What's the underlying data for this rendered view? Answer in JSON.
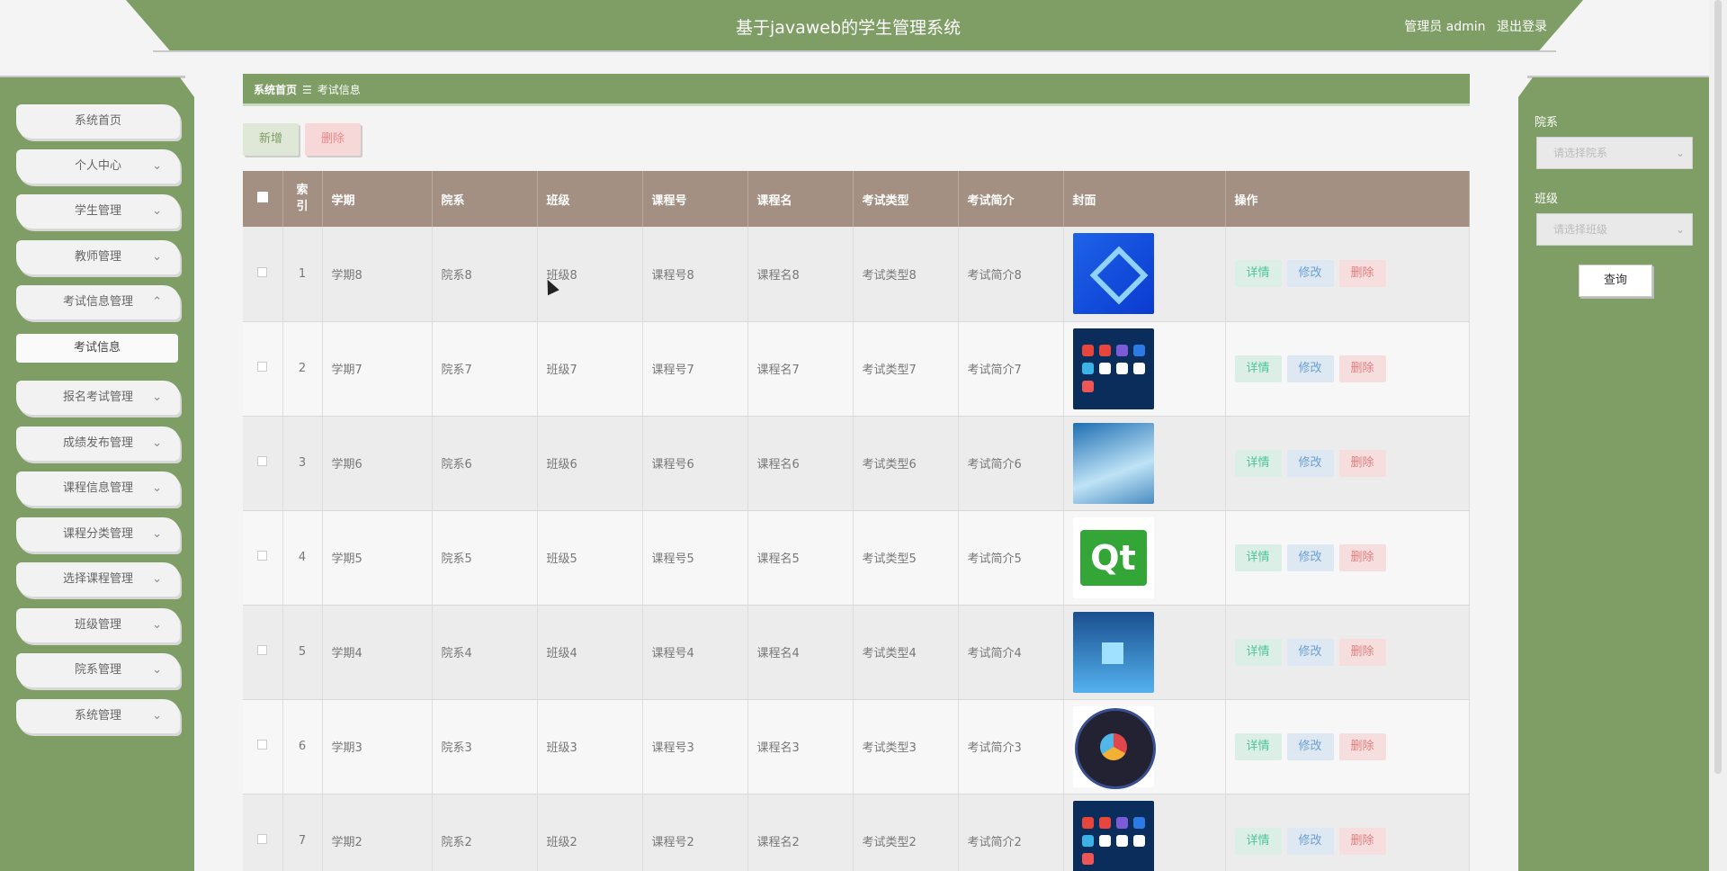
{
  "header": {
    "title": "基于javaweb的学生管理系统",
    "user": "管理员 admin",
    "logout": "退出登录"
  },
  "sidebar": {
    "items": [
      {
        "label": "系统首页",
        "chevron": ""
      },
      {
        "label": "个人中心",
        "chevron": "⌄"
      },
      {
        "label": "学生管理",
        "chevron": "⌄"
      },
      {
        "label": "教师管理",
        "chevron": "⌄"
      },
      {
        "label": "考试信息管理",
        "chevron": "⌃"
      },
      {
        "label": "报名考试管理",
        "chevron": "⌄"
      },
      {
        "label": "成绩发布管理",
        "chevron": "⌄"
      },
      {
        "label": "课程信息管理",
        "chevron": "⌄"
      },
      {
        "label": "课程分类管理",
        "chevron": "⌄"
      },
      {
        "label": "选择课程管理",
        "chevron": "⌄"
      },
      {
        "label": "班级管理",
        "chevron": "⌄"
      },
      {
        "label": "院系管理",
        "chevron": "⌄"
      },
      {
        "label": "系统管理",
        "chevron": "⌄"
      }
    ],
    "submenu": "考试信息"
  },
  "breadcrumb": {
    "home": "系统首页",
    "sep": "☰",
    "current": "考试信息"
  },
  "actions": {
    "add": "新增",
    "delete": "删除"
  },
  "filters": {
    "department_label": "院系",
    "department_placeholder": "请选择院系",
    "class_label": "班级",
    "class_placeholder": "请选择班级",
    "query": "查询"
  },
  "table": {
    "columns": [
      "索引",
      "学期",
      "院系",
      "班级",
      "课程号",
      "课程名",
      "考试类型",
      "考试简介",
      "封面",
      "操作"
    ],
    "index_header": "索\n引",
    "ops": {
      "detail": "详情",
      "edit": "修改",
      "delete": "删除"
    },
    "rows": [
      {
        "idx": "1",
        "term": "学期8",
        "dept": "院系8",
        "cls": "班级8",
        "code": "课程号8",
        "name": "课程名8",
        "type": "考试类型8",
        "intro": "考试简介8",
        "cover": "abstract-blue-logo"
      },
      {
        "idx": "2",
        "term": "学期7",
        "dept": "院系7",
        "cls": "班级7",
        "code": "课程号7",
        "name": "课程名7",
        "type": "考试类型7",
        "intro": "考试简介7",
        "cover": "app-icons-grid"
      },
      {
        "idx": "3",
        "term": "学期6",
        "dept": "院系6",
        "cls": "班级6",
        "code": "课程号6",
        "name": "课程名6",
        "type": "考试类型6",
        "intro": "考试简介6",
        "cover": "laptop-hands"
      },
      {
        "idx": "4",
        "term": "学期5",
        "dept": "院系5",
        "cls": "班级5",
        "code": "课程号5",
        "name": "课程名5",
        "type": "考试类型5",
        "intro": "考试简介5",
        "cover": "qt-logo"
      },
      {
        "idx": "5",
        "term": "学期4",
        "dept": "院系4",
        "cls": "班级4",
        "code": "课程号4",
        "name": "课程名4",
        "type": "考试类型4",
        "intro": "考试简介4",
        "cover": "windows-screen"
      },
      {
        "idx": "6",
        "term": "学期3",
        "dept": "院系3",
        "cls": "班级3",
        "code": "课程号3",
        "name": "课程名3",
        "type": "考试类型3",
        "intro": "考试简介3",
        "cover": "davinci-resolve-logo"
      },
      {
        "idx": "7",
        "term": "学期2",
        "dept": "院系2",
        "cls": "班级2",
        "code": "课程号2",
        "name": "课程名2",
        "type": "考试类型2",
        "intro": "考试简介2",
        "cover": "app-icons-grid"
      }
    ]
  },
  "colors": {
    "primary": "#7f9e65",
    "table_header": "#a39083",
    "detail": "#4fc39a",
    "edit": "#6a9fd2",
    "danger": "#e57e7e"
  }
}
